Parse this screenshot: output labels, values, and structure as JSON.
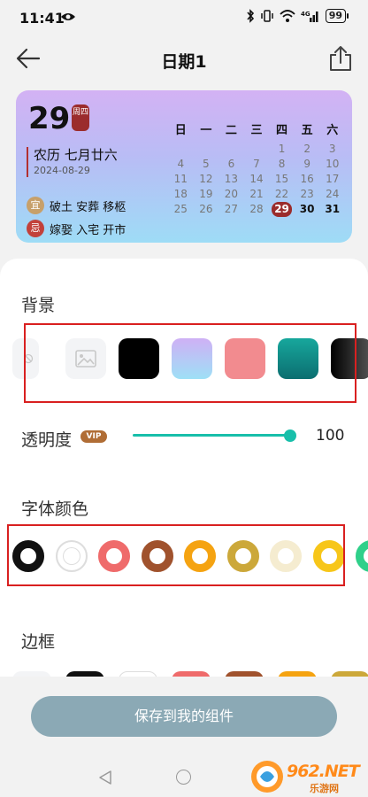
{
  "status": {
    "time": "11:41",
    "battery": "99"
  },
  "header": {
    "title": "日期1"
  },
  "widget": {
    "day": "29",
    "weekday": "周四",
    "lunar": "农历 七月廿六",
    "solar": "2024-08-29",
    "yi_label": "宜",
    "yi_text": "破土 安葬 移柩",
    "ji_label": "忌",
    "ji_text": "嫁娶 入宅 开市",
    "calendar_head": [
      "日",
      "一",
      "二",
      "三",
      "四",
      "五",
      "六"
    ],
    "calendar_rows": [
      [
        "",
        "",
        "",
        "",
        "1",
        "2",
        "3"
      ],
      [
        "4",
        "5",
        "6",
        "7",
        "8",
        "9",
        "10"
      ],
      [
        "11",
        "12",
        "13",
        "14",
        "15",
        "16",
        "17"
      ],
      [
        "18",
        "19",
        "20",
        "21",
        "22",
        "23",
        "24"
      ],
      [
        "25",
        "26",
        "27",
        "28",
        "29",
        "30",
        "31"
      ]
    ]
  },
  "settings": {
    "background_title": "背景",
    "opacity_label": "透明度",
    "vip": "VIP",
    "opacity_value": "100",
    "opacity_fraction": 1.0,
    "font_color_title": "字体颜色",
    "border_title": "边框"
  },
  "background_swatches": [
    "none",
    "image",
    "#000000",
    "gradient-purple-blue",
    "#f28b8f",
    "gradient-teal",
    "gradient-black"
  ],
  "font_colors": [
    "#111111",
    "#dddddd",
    "#ef6b6b",
    "#a0522d",
    "#f5a311",
    "#cca83a",
    "#f5ecd0",
    "#f7c619",
    "#2fd08a"
  ],
  "save_button": {
    "label": "保存到我的组件"
  },
  "watermark": {
    "text": "962.NET",
    "sub": "乐游网"
  }
}
